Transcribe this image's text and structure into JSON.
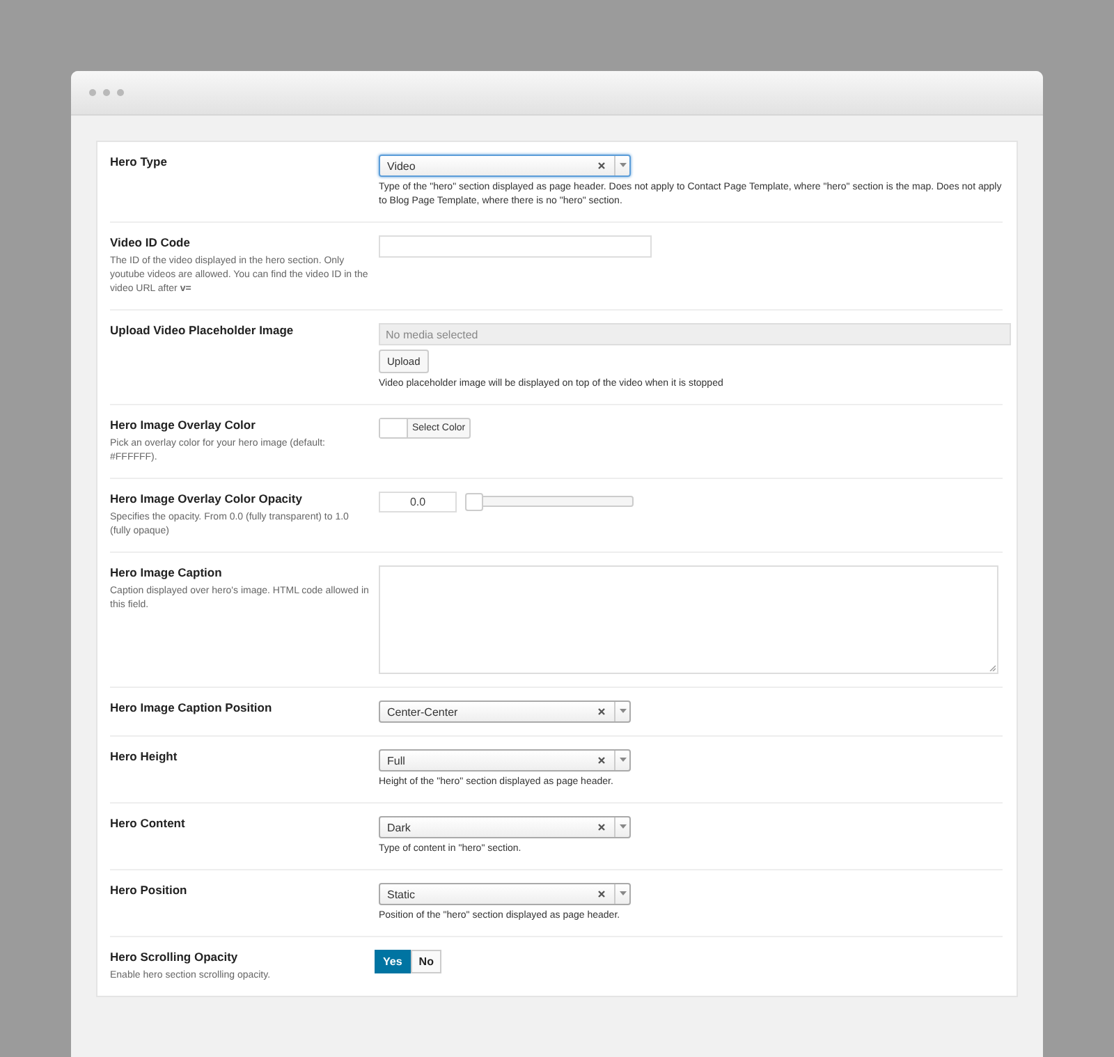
{
  "rows": [
    {
      "kind": "select",
      "label": "Hero Type",
      "value": "Video",
      "focused": true,
      "help": "Type of the \"hero\" section displayed as page header. Does not apply to Contact Page Template, where \"hero\" section is the map. Does not apply to Blog Page Template, where there is no \"hero\" section."
    },
    {
      "kind": "text",
      "label": "Video ID Code",
      "description": "The ID of the video displayed in the hero section. Only youtube videos are allowed. You can find the video ID in the video URL after **v=**"
    },
    {
      "kind": "media",
      "label": "Upload Video Placeholder Image",
      "placeholder": "No media selected",
      "button": "Upload",
      "help": "Video placeholder image will be displayed on top of the video when it is stopped"
    },
    {
      "kind": "color",
      "label": "Hero Image Overlay Color",
      "description": "Pick an overlay color for your hero image (default: #FFFFFF).",
      "color": "#ffffff",
      "button": "Select Color"
    },
    {
      "kind": "slider",
      "label": "Hero Image Overlay Color Opacity",
      "description": "Specifies the opacity. From 0.0 (fully transparent) to 1.0 (fully opaque)",
      "value": "0.0",
      "level": 0
    },
    {
      "kind": "textarea",
      "label": "Hero Image Caption",
      "description": "Caption displayed over hero's image. HTML code allowed in this field."
    },
    {
      "kind": "select",
      "label": "Hero Image Caption Position",
      "value": "Center-Center",
      "focused": false
    },
    {
      "kind": "select",
      "label": "Hero Height",
      "value": "Full",
      "focused": false,
      "help": "Height of the \"hero\" section displayed as page header."
    },
    {
      "kind": "select",
      "label": "Hero Content",
      "value": "Dark",
      "focused": false,
      "help": "Type of content in \"hero\" section."
    },
    {
      "kind": "select",
      "label": "Hero Position",
      "value": "Static",
      "focused": false,
      "help": "Position of the \"hero\" section displayed as page header."
    },
    {
      "kind": "toggle",
      "label": "Hero Scrolling Opacity",
      "description": "Enable hero section scrolling opacity.",
      "options": [
        {
          "label": "Yes",
          "selected": true
        },
        {
          "label": "No",
          "selected": false
        }
      ]
    }
  ]
}
